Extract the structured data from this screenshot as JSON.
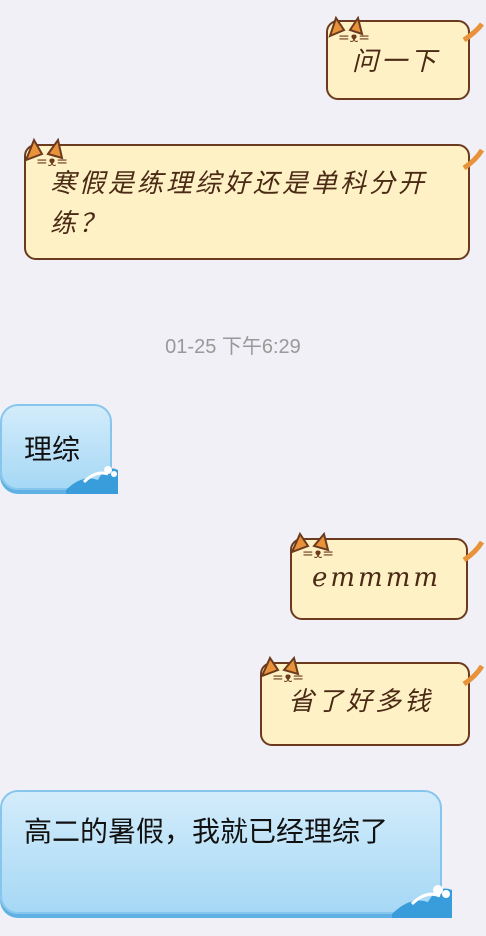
{
  "messages": [
    {
      "text": "问一下"
    },
    {
      "text": "寒假是练理综好还是单科分开练？"
    },
    {
      "text": "理综"
    },
    {
      "text": "emmmm"
    },
    {
      "text": "省了好多钱"
    },
    {
      "text": "高二的暑假，我就已经理综了"
    }
  ],
  "timestamp": "01-25 下午6:29",
  "theme": {
    "cat_bubble": "#fff1c6",
    "cat_border": "#6b3a1f",
    "blue_bubble": "#bde3f8"
  }
}
